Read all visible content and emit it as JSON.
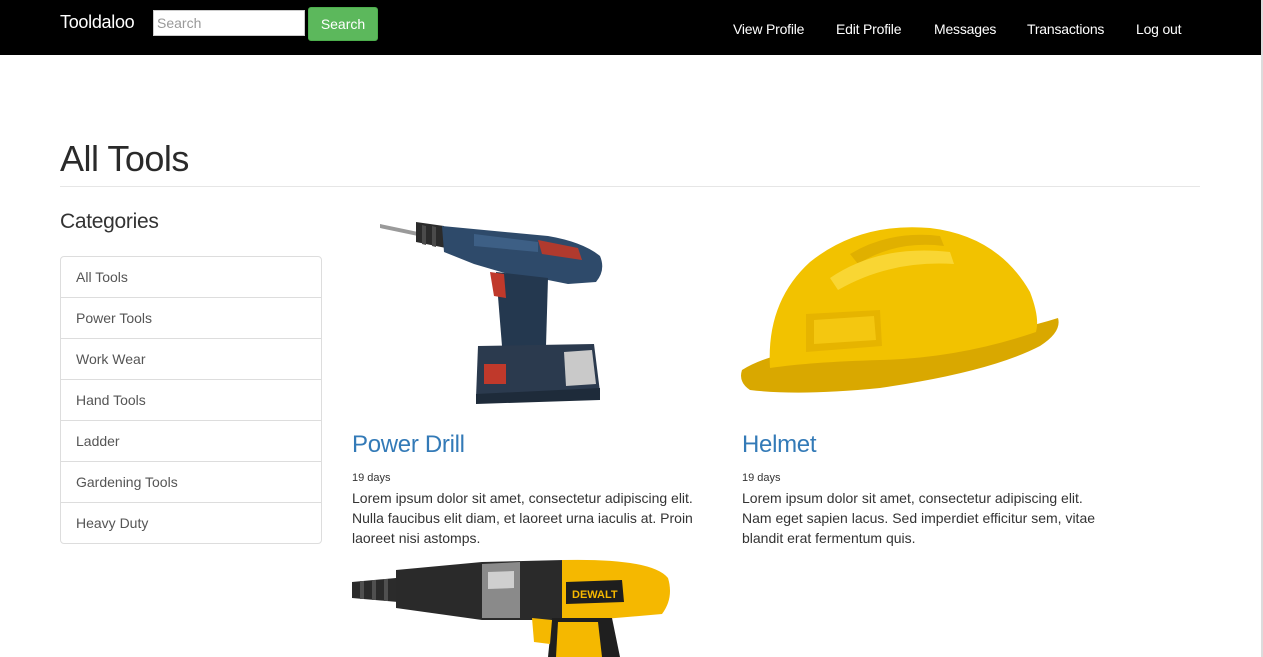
{
  "navbar": {
    "brand": "Tooldaloo",
    "search_placeholder": "Search",
    "search_value": "",
    "search_button": "Search",
    "links": [
      "View Profile",
      "Edit Profile",
      "Messages",
      "Transactions",
      "Log out"
    ]
  },
  "page": {
    "title": "All Tools"
  },
  "categories": {
    "heading": "Categories",
    "items": [
      "All Tools",
      "Power Tools",
      "Work Wear",
      "Hand Tools",
      "Ladder",
      "Gardening Tools",
      "Heavy Duty"
    ]
  },
  "products": [
    {
      "name": "Power Drill",
      "duration": "19 days",
      "description": "Lorem ipsum dolor sit amet, consectetur adipiscing elit. Nulla faucibus elit diam, et laoreet urna iaculis at. Proin laoreet nisi astomps.",
      "image": "power-drill-image"
    },
    {
      "name": "Helmet",
      "duration": "19 days",
      "description": "Lorem ipsum dolor sit amet, consectetur adipiscing elit. Nam eget sapien lacus. Sed imperdiet efficitur sem, vitae blandit erat fermentum quis.",
      "image": "helmet-image"
    },
    {
      "image": "hammer-drill-image",
      "brand_mark": "DEWALT"
    }
  ],
  "colors": {
    "navbar_bg": "#000000",
    "search_button": "#5cb85c",
    "link": "#337ab7",
    "drill_blue": "#2e4a6a",
    "helmet_yellow": "#f2c200",
    "dewalt_yellow": "#f5b800"
  }
}
